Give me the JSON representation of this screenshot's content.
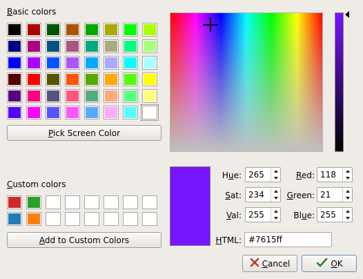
{
  "basic": {
    "label_accel": "B",
    "label_rest": "asic colors",
    "colors": [
      "#000000",
      "#aa0000",
      "#005500",
      "#aa5500",
      "#00aa00",
      "#aaaa00",
      "#00ff00",
      "#aaff00",
      "#00007f",
      "#aa007f",
      "#00557f",
      "#aa557f",
      "#00aa7f",
      "#aaaa7f",
      "#00ff7f",
      "#aaff7f",
      "#0000ff",
      "#aa00ff",
      "#0055ff",
      "#aa55ff",
      "#00aaff",
      "#aaaaff",
      "#00ffff",
      "#aaffff",
      "#550000",
      "#ff0000",
      "#555500",
      "#ff5500",
      "#55aa00",
      "#ffaa00",
      "#55ff00",
      "#ffff00",
      "#55007f",
      "#ff007f",
      "#55557f",
      "#ff557f",
      "#55aa7f",
      "#ffaa7f",
      "#55ff7f",
      "#ffff7f",
      "#5500ff",
      "#ff00ff",
      "#5555ff",
      "#ff55ff",
      "#55aaff",
      "#ffaaff",
      "#55ffff",
      "#ffffff"
    ],
    "selected_index": 47
  },
  "pick_button": {
    "accel": "P",
    "rest": "ick Screen Color"
  },
  "custom": {
    "label_accel": "C",
    "label_rest": "ustom colors",
    "colors": [
      "#cc2a2a",
      "#2aa02a",
      "",
      "",
      "",
      "",
      "",
      "",
      "#1f7dbc",
      "#ff7f0e",
      "",
      "",
      "",
      "",
      "",
      ""
    ]
  },
  "add_button": {
    "accel": "A",
    "rest": "dd to Custom Colors"
  },
  "picker": {
    "hue_fraction": 0.26,
    "sat_fraction": 0.92
  },
  "value_bar_fraction": 1.0,
  "current_color": "#7615ff",
  "fields": {
    "hue": {
      "accel": "u",
      "pre": "H",
      "post": "e:",
      "value": "265"
    },
    "sat": {
      "accel": "S",
      "pre": "",
      "post": "at:",
      "value": "234"
    },
    "val": {
      "accel": "V",
      "pre": "",
      "post": "al:",
      "value": "255"
    },
    "red": {
      "accel": "R",
      "pre": "",
      "post": "ed:",
      "value": "118"
    },
    "green": {
      "accel": "G",
      "pre": "",
      "post": "reen:",
      "value": "21"
    },
    "blue": {
      "accel": "u",
      "pre": "Bl",
      "post": "e:",
      "value": "255"
    },
    "html": {
      "accel": "H",
      "pre": "",
      "post": "TML:",
      "value": "#7615ff"
    }
  },
  "cancel_button": {
    "accel": "C",
    "rest": "ancel",
    "icon": "cancel-x-icon"
  },
  "ok_button": {
    "accel": "O",
    "rest": "K",
    "icon": "ok-check-icon"
  }
}
